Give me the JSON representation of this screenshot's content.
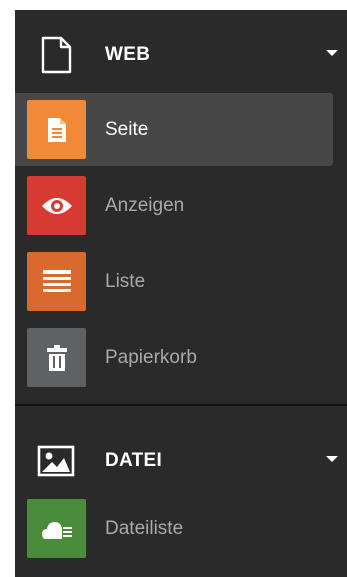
{
  "sidebar": {
    "sections": [
      {
        "label": "WEB",
        "icon": "page-outline-icon",
        "expanded": true,
        "items": [
          {
            "label": "Seite",
            "icon": "page-icon",
            "color": "#f08a36",
            "active": true
          },
          {
            "label": "Anzeigen",
            "icon": "eye-icon",
            "color": "#d63a33",
            "active": false
          },
          {
            "label": "Liste",
            "icon": "list-icon",
            "color": "#d9692f",
            "active": false
          },
          {
            "label": "Papierkorb",
            "icon": "trash-icon",
            "color": "#5f6264",
            "active": false
          }
        ]
      },
      {
        "label": "DATEI",
        "icon": "image-icon",
        "expanded": true,
        "items": [
          {
            "label": "Dateiliste",
            "icon": "cloud-list-icon",
            "color": "#4a8c3c",
            "active": false
          }
        ]
      }
    ]
  },
  "colors": {
    "sidebar_background": "#2a2a2a",
    "active_item_background": "#474747",
    "active_text": "#ffffff",
    "inactive_text": "#a9a9a9",
    "divider": "#121212"
  }
}
